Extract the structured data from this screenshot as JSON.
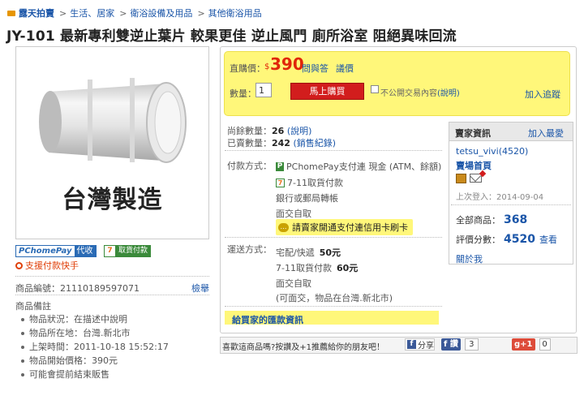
{
  "breadcrumb": [
    "露天拍賣",
    "生活、居家",
    "衛浴設備及用品",
    "其他衛浴用品"
  ],
  "title": "JY-101 最新專利雙逆止葉片 較果更佳 逆止風門 廁所浴室 阻絕異味回流",
  "image": {
    "overlay_text": "台灣製造"
  },
  "badges": {
    "pchome_brand": "PChomePay",
    "pchome_tag": "代收",
    "seven_icon": "7",
    "seven_tag": "取貨付款",
    "support_fast_pay": "支援付款快手"
  },
  "item": {
    "number": "商品編號：21110189597071",
    "report": "檢舉",
    "notes_title": "商品備註",
    "notes": [
      "物品狀況：在描述中說明",
      "物品所在地：台灣.新北市",
      "上架時間：2011-10-18 15:52:17",
      "物品開始價格：390元",
      "可能會提前結束販售"
    ]
  },
  "buy": {
    "price_label": "直購價：",
    "currency": "$",
    "price": "390",
    "qa": "問與答",
    "bid": "議價",
    "qty_label": "數量：",
    "qty_value": "1",
    "buy_now": "馬上購買",
    "private_label": "不公開交易內容",
    "private_link": "(說明)",
    "add_watch": "加入追蹤"
  },
  "stock": {
    "remaining_label": "尚餘數量：",
    "remaining": "26",
    "remaining_link": "(說明)",
    "sold_label": "已賣數量：",
    "sold": "242",
    "sold_link": "(銷售紀錄)"
  },
  "payment": {
    "label": "付款方式：",
    "methods": [
      "PChomePay支付連 現金 (ATM、餘額)",
      "7-11取貨付款",
      "銀行或郵局轉帳",
      "面交自取"
    ],
    "credit_notice": "請賣家開通支付連信用卡刷卡"
  },
  "shipping": {
    "label": "運送方式：",
    "options": [
      {
        "name": "宅配/快遞",
        "price": "50元"
      },
      {
        "name": "7-11取貨付款",
        "price": "60元"
      },
      {
        "name": "面交自取",
        "price": ""
      },
      {
        "name": "(可面交，物品在台灣.新北市)",
        "price": ""
      }
    ]
  },
  "bank_info": "給買家的匯款資訊",
  "seller": {
    "title": "賣家資訊",
    "add_fav": "加入最愛",
    "name": "tetsu_vivi(4520)",
    "store": "賣場首頁",
    "last_login": "上次登入：2014-09-04",
    "total_label": "全部商品：",
    "total": "368",
    "rating_label": "評價分數：",
    "rating": "4520",
    "rating_view": "查看",
    "about": "關於我"
  },
  "share": {
    "text": "喜歡這商品嗎?按讚及+1推薦給你的朋友吧！",
    "fb_share": "分享",
    "fb_like": "讚",
    "fb_like_count": "3",
    "gplus": "g+1",
    "gplus_count": "0"
  }
}
